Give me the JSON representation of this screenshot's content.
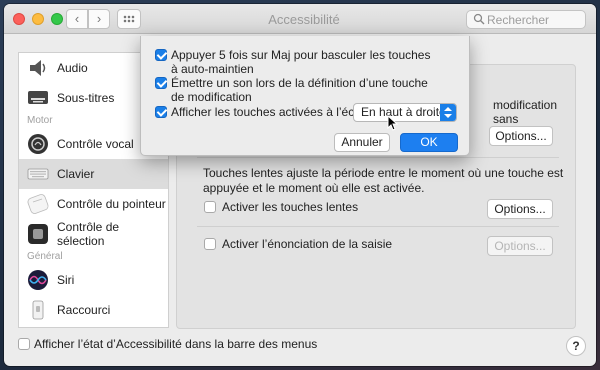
{
  "window": {
    "title": "Accessibilité",
    "search_placeholder": "Rechercher"
  },
  "sidebar": {
    "items": [
      {
        "label": "Audio",
        "icon": "speaker-icon"
      },
      {
        "label": "Sous-titres",
        "icon": "captions-icon"
      }
    ],
    "section_motor": "Motor",
    "motor_items": [
      {
        "label": "Contrôle vocal",
        "icon": "voice-control-icon"
      },
      {
        "label": "Clavier",
        "icon": "keyboard-icon",
        "selected": true
      },
      {
        "label": "Contrôle du pointeur",
        "icon": "pointer-icon"
      },
      {
        "label": "Contrôle de sélection",
        "icon": "switch-control-icon"
      }
    ],
    "section_general": "Général",
    "general_items": [
      {
        "label": "Siri",
        "icon": "siri-icon"
      },
      {
        "label": "Raccourci",
        "icon": "shortcut-icon"
      }
    ]
  },
  "main": {
    "partial_right_text": "modification sans",
    "options_label": "Options...",
    "slow_keys_description_1": "Touches lentes ajuste la période entre le moment où une touche est",
    "slow_keys_description_2": "appuyée et le moment où elle est activée.",
    "slow_keys_label": "Activer les touches lentes",
    "slow_keys_checked": false,
    "slow_keys_options": "Options...",
    "typing_feedback_label": "Activer l’énonciation de la saisie",
    "typing_feedback_checked": false,
    "typing_feedback_options": "Options..."
  },
  "footer": {
    "menu_bar_label": "Afficher l’état d’Accessibilité dans la barre des menus",
    "menu_bar_checked": false,
    "help": "?"
  },
  "sheet": {
    "option1_line1": "Appuyer 5 fois sur Maj pour basculer les touches",
    "option1_line2": "à auto-maintien",
    "option1_checked": true,
    "option2_line1": "Émettre un son lors de la définition d’une touche",
    "option2_line2": "de modification",
    "option2_checked": true,
    "option3_label": "Afficher les touches activées à l’écran :",
    "option3_checked": true,
    "position_selected": "En haut à droite",
    "cancel_label": "Annuler",
    "ok_label": "OK"
  },
  "colors": {
    "accent": "#1d7ff0",
    "window_bg": "#ececec"
  }
}
